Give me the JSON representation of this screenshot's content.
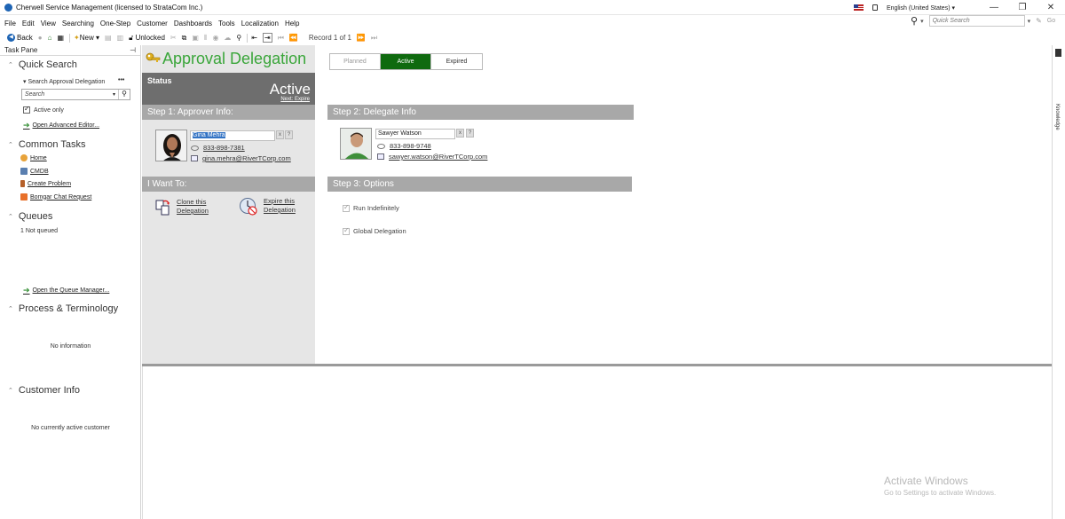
{
  "window": {
    "title": "Cherwell Service Management (licensed to StrataCom Inc.)",
    "language": "English (United States)",
    "minimize": "—",
    "restore": "❐",
    "close": "✕"
  },
  "menu": [
    "File",
    "Edit",
    "View",
    "Searching",
    "One-Step",
    "Customer",
    "Dashboards",
    "Tools",
    "Localization",
    "Help"
  ],
  "quick_search": {
    "placeholder": "Quick Search",
    "go_label": "Go"
  },
  "toolbar": {
    "back": "Back",
    "new": "New",
    "unlocked": "Unlocked",
    "record": "Record 1 of 1"
  },
  "task_pane": {
    "title": "Task Pane",
    "quick_search": {
      "title": "Quick Search",
      "search_scope": "Search Approval Delegation",
      "more": "•••",
      "search_placeholder": "Search",
      "active_only": "Active only",
      "open_advanced": "Open Advanced Editor..."
    },
    "common_tasks": {
      "title": "Common Tasks",
      "items": [
        "Home",
        "CMDB",
        "Create Problem",
        "Bomgar Chat Request"
      ]
    },
    "queues": {
      "title": "Queues",
      "status": "1 Not queued",
      "open_manager": "Open the Queue Manager..."
    },
    "process": {
      "title": "Process & Terminology",
      "empty": "No information"
    },
    "customer": {
      "title": "Customer Info",
      "empty": "No currently active customer"
    }
  },
  "form": {
    "title": "Approval Delegation",
    "status_label": "Status",
    "status_value": "Active",
    "next_action": "Next: Expire",
    "step1": {
      "header": "Step 1: Approver Info:",
      "name": "Gina Mehra",
      "phone": "833-898-7381",
      "email": "gina.mehra@RiverTCorp.com"
    },
    "step2": {
      "header": "Step 2: Delegate Info",
      "name": "Sawyer Watson",
      "phone": "833-898-9748",
      "email": "sawyer.watson@RiverTCorp.com"
    },
    "i_want_to": {
      "header": "I Want To:",
      "clone_line1": "Clone this",
      "clone_line2": "Delegation",
      "expire_line1": "Expire this",
      "expire_line2": "Delegation"
    },
    "step3": {
      "header": "Step 3: Options",
      "run_indefinitely": "Run Indefinitely",
      "global_delegation": "Global Delegation"
    },
    "tabs": [
      "Planned",
      "Active",
      "Expired"
    ],
    "active_tab": "Active",
    "field_button_x": "x",
    "field_button_q": "?"
  },
  "right_strip": {
    "label": "Knowledge"
  },
  "watermark": {
    "line1": "Activate Windows",
    "line2": "Go to Settings to activate Windows."
  },
  "colors": {
    "accent_green": "#3aa63a",
    "active_tab": "#0f6a0f",
    "header_gray": "#a8a8a8",
    "status_gray": "#6e6e6e"
  }
}
